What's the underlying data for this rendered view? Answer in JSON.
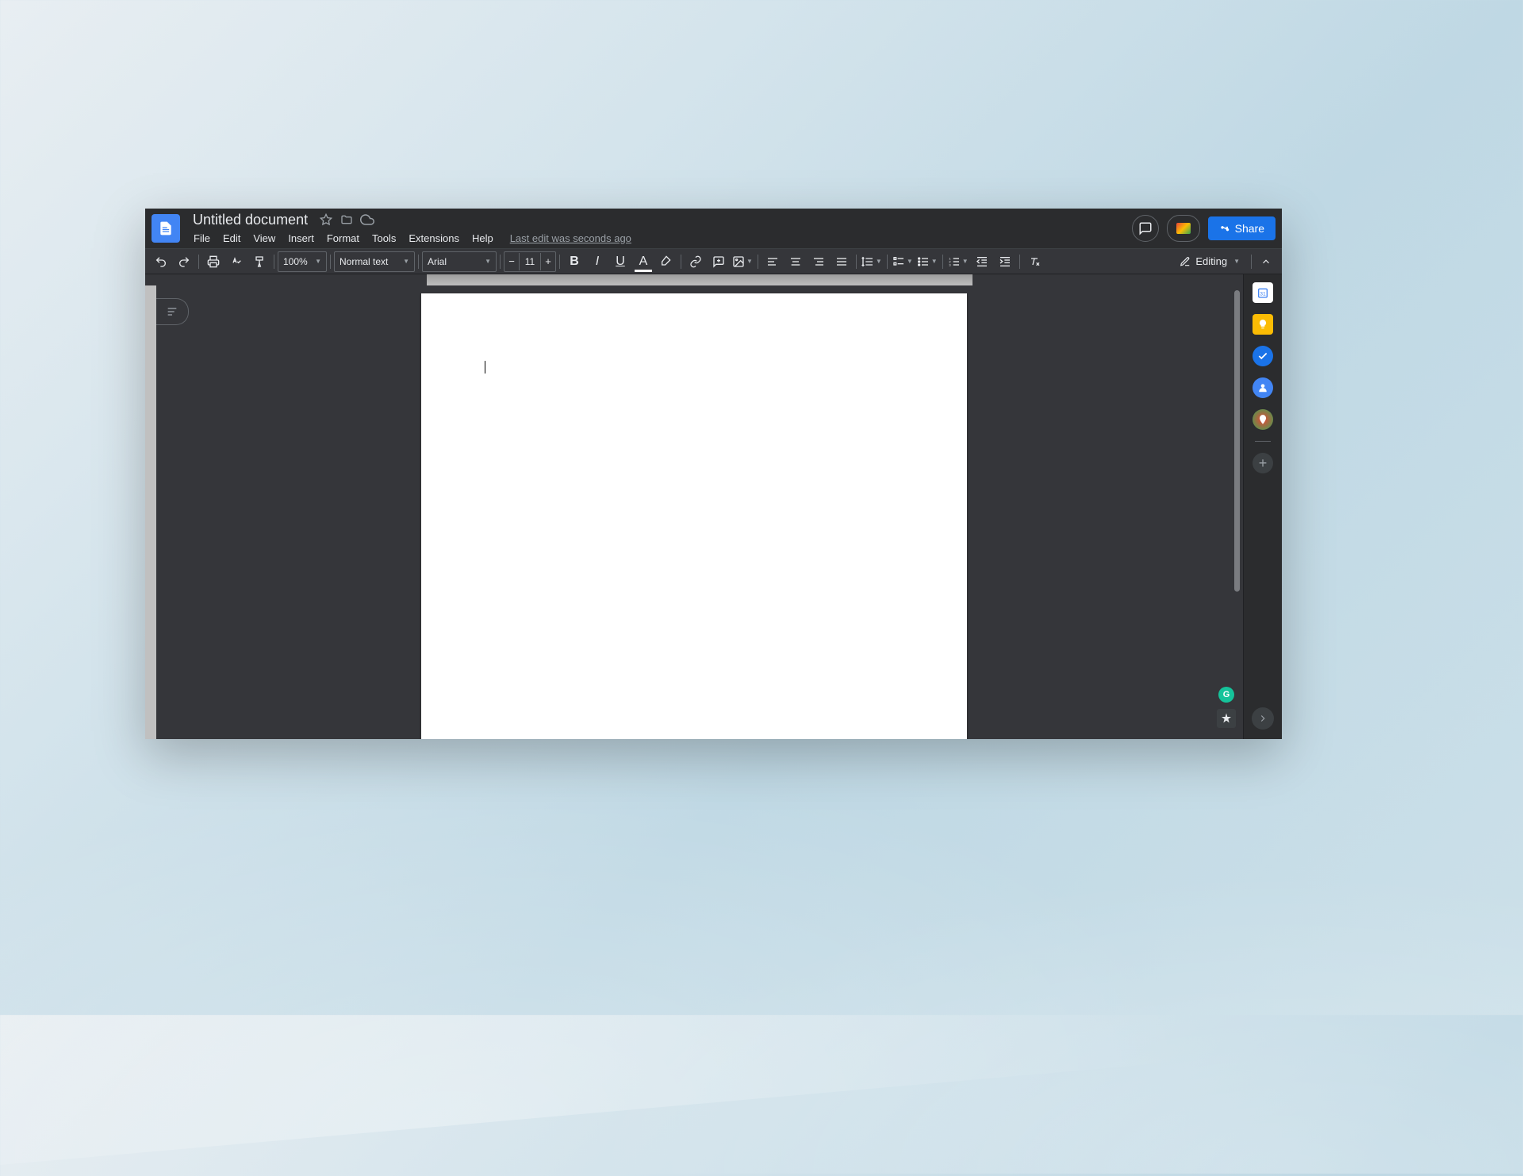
{
  "header": {
    "document_title": "Untitled document",
    "share_label": "Share",
    "last_edit": "Last edit was seconds ago",
    "menu": [
      "File",
      "Edit",
      "View",
      "Insert",
      "Format",
      "Tools",
      "Extensions",
      "Help"
    ]
  },
  "toolbar": {
    "zoom": "100%",
    "style": "Normal text",
    "font": "Arial",
    "font_size": "11",
    "mode": "Editing"
  },
  "sidepanel": {
    "apps": [
      "calendar",
      "keep",
      "tasks",
      "contacts",
      "maps"
    ]
  }
}
